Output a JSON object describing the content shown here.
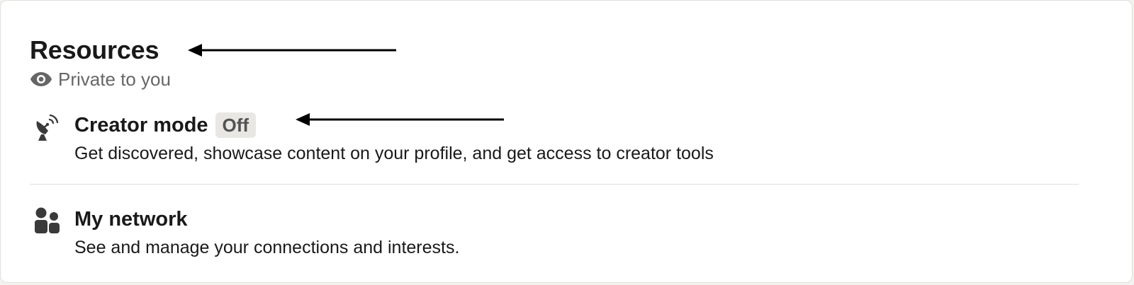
{
  "section": {
    "title": "Resources",
    "privacy_label": "Private to you"
  },
  "items": [
    {
      "icon": "satellite-dish-icon",
      "label": "Creator mode",
      "badge": "Off",
      "description": "Get discovered, showcase content on your profile, and get access to creator tools"
    },
    {
      "icon": "people-icon",
      "label": "My network",
      "description": "See and manage your connections and interests."
    }
  ],
  "annotations": {
    "arrow_color": "#000000"
  },
  "colors": {
    "text_primary": "#191919",
    "text_secondary": "#666666",
    "badge_bg": "#e9e7e3"
  }
}
